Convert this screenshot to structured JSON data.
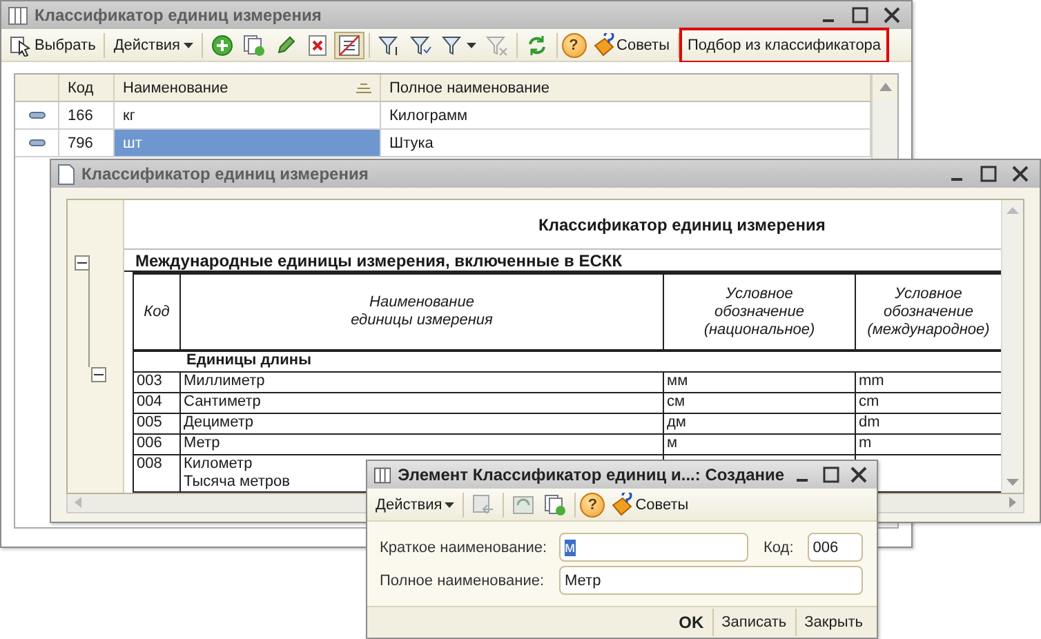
{
  "main_window": {
    "title": "Классификатор единиц измерения",
    "active": false,
    "toolbar": {
      "select": "Выбрать",
      "actions": "Действия",
      "tips": "Советы",
      "help": "?",
      "pick": "Подбор из классификатора",
      "pick_highlighted": true
    },
    "columns": [
      {
        "label": "Код",
        "sorted": false
      },
      {
        "label": "Наименование",
        "sorted": true
      },
      {
        "label": "Полное наименование",
        "sorted": false
      }
    ],
    "rows": [
      {
        "code": "166",
        "name": "кг",
        "full": "Килограмм",
        "selected": false
      },
      {
        "code": "796",
        "name": "шт",
        "full": "Штука",
        "selected": true
      }
    ]
  },
  "report_window": {
    "title": "Классификатор единиц измерения",
    "active": false,
    "heading": "Классификатор единиц измерения",
    "section": "Международные единицы измерения, включенные в ЕСКК",
    "columns": [
      "Код",
      "Наименование\nединицы измерения",
      "Условное\nобозначение\n(национальное)",
      "Условное\nобозначение\n(международное)"
    ],
    "group": "Единицы длины",
    "rows": [
      {
        "code": "003",
        "name": "Миллиметр",
        "national": "мм",
        "international": "mm"
      },
      {
        "code": "004",
        "name": "Сантиметр",
        "national": "см",
        "international": "cm"
      },
      {
        "code": "005",
        "name": "Дециметр",
        "national": "дм",
        "international": "dm"
      },
      {
        "code": "006",
        "name": "Метр",
        "national": "м",
        "international": "m"
      },
      {
        "code": "008",
        "name": "Километр\nТысяча метров",
        "national": "",
        "international": ""
      }
    ]
  },
  "dialog": {
    "title": "Элемент Классификатор единиц и...: Создание",
    "active": true,
    "toolbar": {
      "actions": "Действия",
      "help": "?",
      "tips": "Советы"
    },
    "short_name_label": "Краткое наименование:",
    "short_name": "м",
    "short_name_selected": true,
    "code_label": "Код:",
    "code": "006",
    "full_name_label": "Полное наименование:",
    "full_name": "Метр",
    "buttons": [
      {
        "label": "OK",
        "default": true
      },
      {
        "label": "Записать",
        "default": false
      },
      {
        "label": "Закрыть",
        "default": false
      }
    ]
  }
}
